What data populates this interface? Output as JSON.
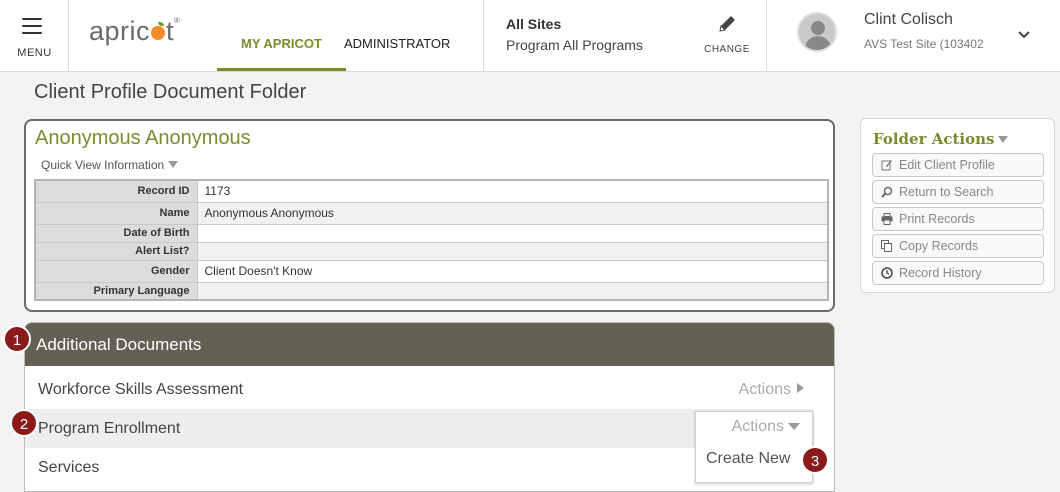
{
  "header": {
    "menu_label": "MENU",
    "logo_text_a": "apric",
    "logo_text_b": "t",
    "logo_tm": "®",
    "tabs": [
      {
        "label": "MY APRICOT",
        "active": true
      },
      {
        "label": "ADMINISTRATOR",
        "active": false
      }
    ],
    "sites": {
      "line1": "All Sites",
      "line2": "Program All Programs",
      "change_label": "CHANGE"
    },
    "user": {
      "name": "Clint Colisch",
      "site": "AVS Test Site (103402"
    }
  },
  "page_title": "Client Profile Document Folder",
  "client": {
    "name": "Anonymous Anonymous",
    "quick_view_label": "Quick View Information",
    "fields": [
      {
        "label": "Record ID",
        "value": "1173"
      },
      {
        "label": "Name",
        "value": "Anonymous Anonymous"
      },
      {
        "label": "Date of Birth",
        "value": ""
      },
      {
        "label": "Alert List?",
        "value": ""
      },
      {
        "label": "Gender",
        "value": "Client Doesn't Know"
      },
      {
        "label": "Primary Language",
        "value": ""
      }
    ]
  },
  "additional_documents": {
    "title": "Additional Documents",
    "rows": [
      {
        "label": "Workforce Skills Assessment",
        "actions_label": "Actions"
      },
      {
        "label": "Program Enrollment",
        "actions_label": "Actions"
      },
      {
        "label": "Services",
        "actions_label": ""
      }
    ],
    "dropdown": {
      "actions_label": "Actions",
      "item": "Create New"
    }
  },
  "callouts": [
    "1",
    "2",
    "3"
  ],
  "folder_actions": {
    "title": "Folder Actions",
    "buttons": [
      {
        "label": "Edit Client Profile",
        "icon": "edit-icon"
      },
      {
        "label": "Return to Search",
        "icon": "search-icon"
      },
      {
        "label": "Print Records",
        "icon": "printer-icon"
      },
      {
        "label": "Copy Records",
        "icon": "copy-icon"
      },
      {
        "label": "Record History",
        "icon": "clock-icon"
      }
    ]
  },
  "colors": {
    "accent": "#7a8c2e",
    "header_bar": "#636054",
    "callout": "#8b1a1a",
    "logo_orange": "#f28c28"
  }
}
